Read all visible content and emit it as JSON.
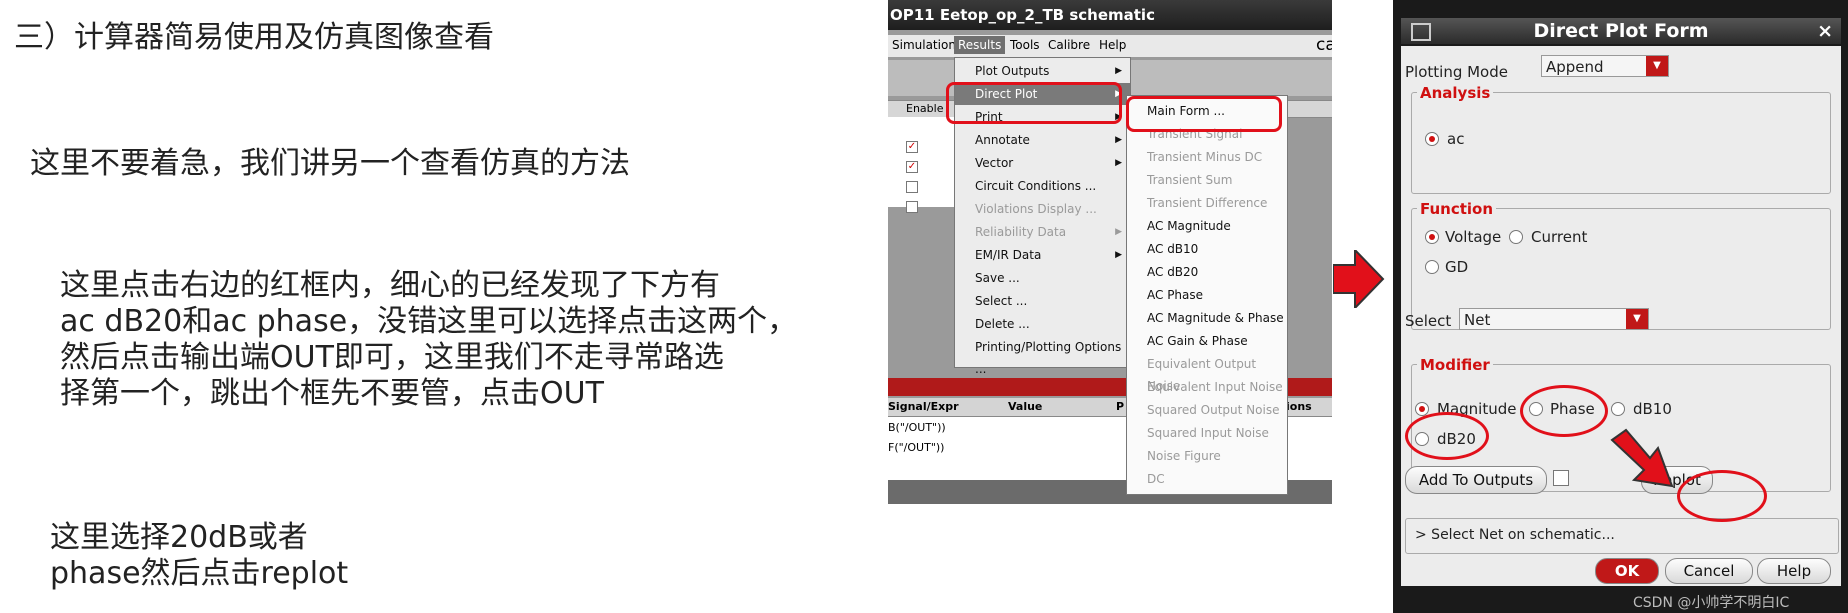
{
  "slide": {
    "title": "三）计算器简易使用及仿真图像查看",
    "para1": "这里不要着急，我们讲另一个查看仿真的方法",
    "para2_lines": [
      "这里点击右边的红框内，细心的已经发现了下方有",
      "ac dB20和ac phase，没错这里可以选择点击这两个，",
      "然后点击输出端OUT即可，这里我们不走寻常路选",
      "择第一个，跳出个框先不要管，点击OUT"
    ],
    "para3_lines": [
      "这里选择20dB或者",
      "phase然后点击replot"
    ]
  },
  "schematic": {
    "window_title": "OP11 Eetop_op_2_TB schematic",
    "menubar": [
      "Simulation",
      "Results",
      "Tools",
      "Calibre",
      "Help"
    ],
    "brand_fragment": "ca",
    "enable_header": "Enable",
    "outputs_header": {
      "col1": "Signal/Expr",
      "col2": "Value",
      "col3": "P",
      "col4": "ions"
    },
    "output_rows": [
      "B(\"/OUT\"))",
      "F(\"/OUT\"))"
    ],
    "results_menu": [
      {
        "label": "Plot Outputs",
        "submenu": true,
        "disabled": false
      },
      {
        "label": "Direct Plot",
        "submenu": true,
        "disabled": false,
        "highlighted": true
      },
      {
        "label": "Print",
        "submenu": true,
        "disabled": false
      },
      {
        "label": "Annotate",
        "submenu": true,
        "disabled": false
      },
      {
        "label": "Vector",
        "submenu": true,
        "disabled": false
      },
      {
        "label": "Circuit Conditions ...",
        "submenu": false,
        "disabled": false
      },
      {
        "label": "Violations Display ...",
        "submenu": false,
        "disabled": true
      },
      {
        "label": "Reliability Data",
        "submenu": true,
        "disabled": true
      },
      {
        "label": "EM/IR Data",
        "submenu": true,
        "disabled": false
      },
      {
        "label": "Save ...",
        "submenu": false,
        "disabled": false
      },
      {
        "label": "Select ...",
        "submenu": false,
        "disabled": false
      },
      {
        "label": "Delete ...",
        "submenu": false,
        "disabled": false
      },
      {
        "label": "Printing/Plotting Options ...",
        "submenu": false,
        "disabled": false
      }
    ],
    "direct_plot_menu": [
      {
        "label": "Main Form ...",
        "disabled": false
      },
      {
        "label": "Transient Signal",
        "disabled": true
      },
      {
        "label": "Transient Minus DC",
        "disabled": true
      },
      {
        "label": "Transient Sum",
        "disabled": true
      },
      {
        "label": "Transient Difference",
        "disabled": true
      },
      {
        "label": "AC Magnitude",
        "disabled": false
      },
      {
        "label": "AC dB10",
        "disabled": false
      },
      {
        "label": "AC dB20",
        "disabled": false
      },
      {
        "label": "AC Phase",
        "disabled": false
      },
      {
        "label": "AC Magnitude & Phase",
        "disabled": false
      },
      {
        "label": "AC Gain & Phase",
        "disabled": false
      },
      {
        "label": "Equivalent Output Noise",
        "disabled": true
      },
      {
        "label": "Equivalent Input Noise",
        "disabled": true
      },
      {
        "label": "Squared Output Noise",
        "disabled": true
      },
      {
        "label": "Squared Input Noise",
        "disabled": true
      },
      {
        "label": "Noise Figure",
        "disabled": true
      },
      {
        "label": "DC",
        "disabled": true
      }
    ]
  },
  "dialog": {
    "title": "Direct Plot Form",
    "close": "×",
    "plotting_mode_label": "Plotting Mode",
    "plotting_mode_value": "Append",
    "analysis_label": "Analysis",
    "analysis_option": "ac",
    "function_label": "Function",
    "function_options": [
      "Voltage",
      "Current",
      "GD"
    ],
    "select_label": "Select",
    "select_value": "Net",
    "modifier_label": "Modifier",
    "modifier_options": [
      "Magnitude",
      "Phase",
      "dB10",
      "dB20"
    ],
    "add_to_outputs": "Add To Outputs",
    "replot": "Replot",
    "hint": "> Select Net on schematic...",
    "ok": "OK",
    "cancel": "Cancel",
    "help": "Help",
    "watermark": "CSDN @小帅学不明白IC"
  },
  "colors": {
    "accent_red": "#e1101a",
    "dialog_red": "#d01010"
  }
}
